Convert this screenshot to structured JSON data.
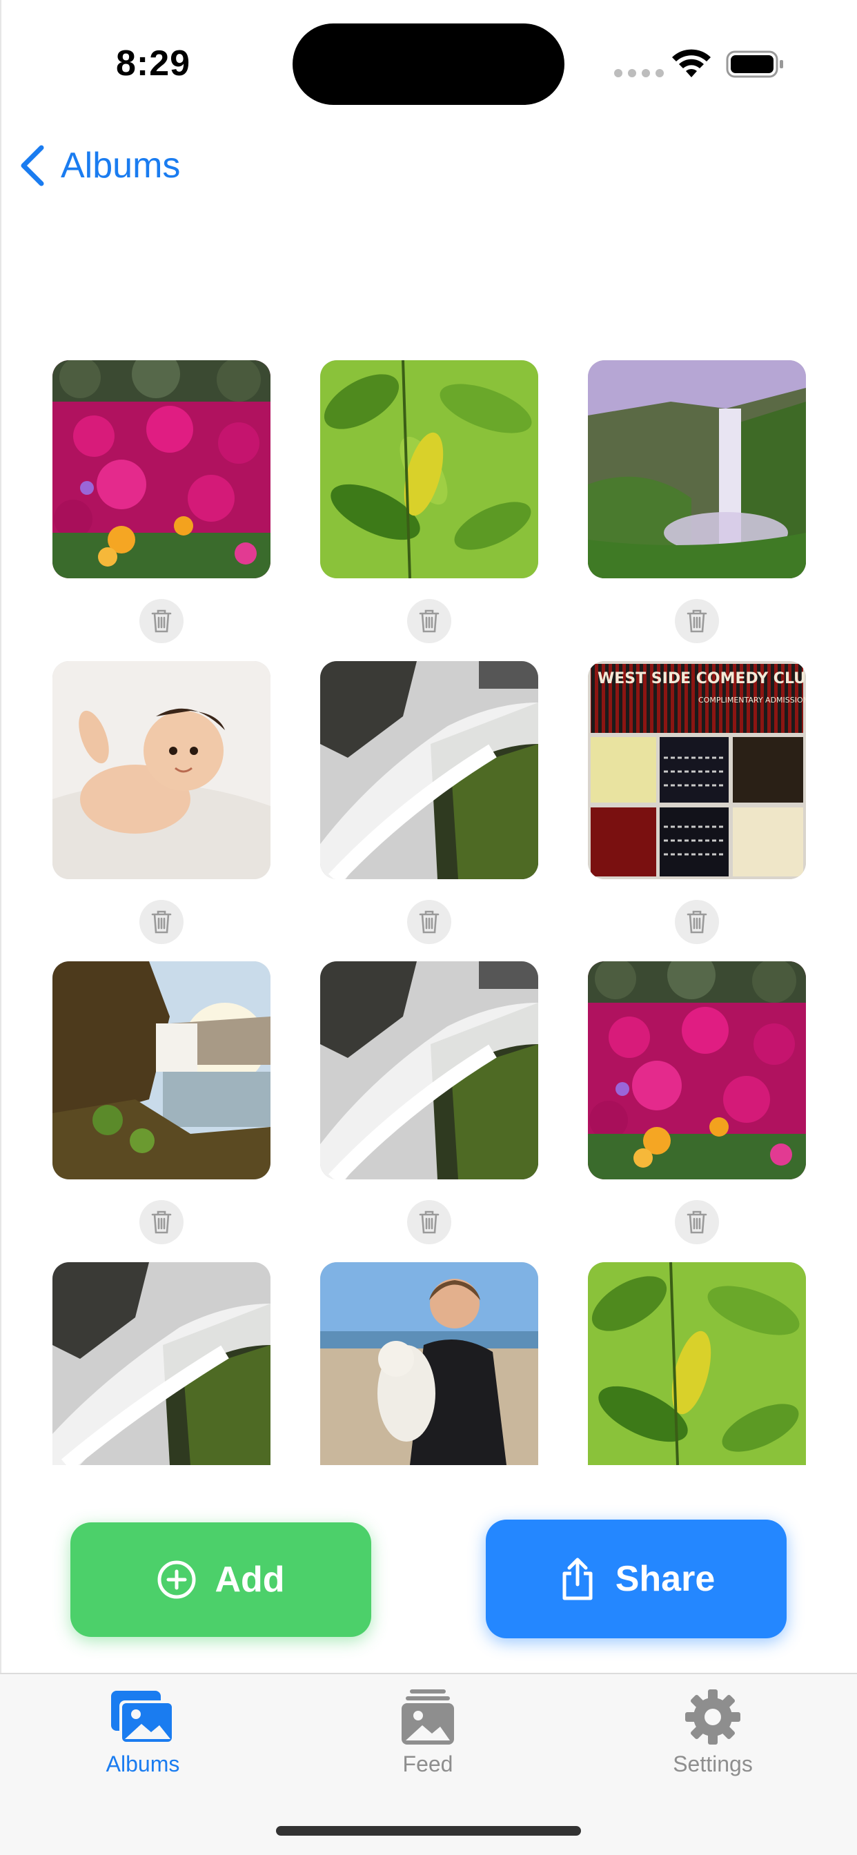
{
  "status": {
    "time": "8:29"
  },
  "nav": {
    "back_label": "Albums"
  },
  "photos": [
    {
      "name": "photo-pink-flowers"
    },
    {
      "name": "photo-green-leaves"
    },
    {
      "name": "photo-waterfall-cliff"
    },
    {
      "name": "photo-baby"
    },
    {
      "name": "photo-waterfall-rocks"
    },
    {
      "name": "photo-comedy-club-tickets"
    },
    {
      "name": "photo-waterfall-sunset"
    },
    {
      "name": "photo-waterfall-rocks"
    },
    {
      "name": "photo-pink-flowers"
    },
    {
      "name": "photo-waterfall-rocks"
    },
    {
      "name": "photo-woman-with-baby-beach"
    },
    {
      "name": "photo-green-leaves"
    }
  ],
  "ticket_text": {
    "title": "WEST SIDE COMEDY CLUB",
    "subtitle": "COMPLIMENTARY ADMISSION FOR TWO GUESTS"
  },
  "actions": {
    "add_label": "Add",
    "share_label": "Share"
  },
  "tabs": [
    {
      "label": "Albums",
      "icon": "photo-stack-icon",
      "active": true
    },
    {
      "label": "Feed",
      "icon": "feed-icon",
      "active": false
    },
    {
      "label": "Settings",
      "icon": "gear-icon",
      "active": false
    }
  ],
  "colors": {
    "accent": "#1a7cf0",
    "add": "#4cd06a",
    "share": "#2487ff",
    "inactive": "#8e8e8e"
  }
}
